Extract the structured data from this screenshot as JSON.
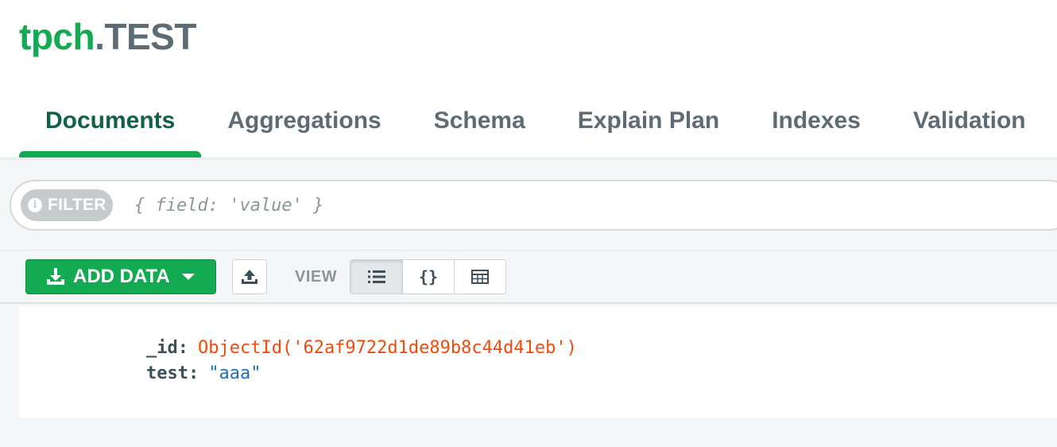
{
  "header": {
    "database": "tpch",
    "collection": ".TEST"
  },
  "tabs": [
    {
      "label": "Documents",
      "active": true
    },
    {
      "label": "Aggregations",
      "active": false
    },
    {
      "label": "Schema",
      "active": false
    },
    {
      "label": "Explain Plan",
      "active": false
    },
    {
      "label": "Indexes",
      "active": false
    },
    {
      "label": "Validation",
      "active": false
    }
  ],
  "filter": {
    "label": "FILTER",
    "icon": "info-icon",
    "placeholder": "{ field: 'value' }",
    "value": ""
  },
  "toolbar": {
    "add_data_label": "ADD DATA",
    "add_data_icon": "download-icon",
    "export_icon": "export-icon",
    "view_label": "VIEW",
    "view_modes": [
      {
        "name": "list-view",
        "icon": "list-icon",
        "active": true
      },
      {
        "name": "json-view",
        "icon": "braces-icon",
        "glyph": "{}",
        "active": false
      },
      {
        "name": "table-view",
        "icon": "table-icon",
        "active": false
      }
    ]
  },
  "documents": [
    {
      "fields": [
        {
          "key": "_id",
          "value": "ObjectId('62af9722d1de89b8c44d41eb')",
          "type": "objectid"
        },
        {
          "key": "test",
          "value": "\"aaa\"",
          "type": "string"
        }
      ]
    }
  ],
  "colors": {
    "brand_green": "#13aa52",
    "active_tab_text": "#116149",
    "objectid_value": "#ef4c0c",
    "string_value": "#1a6ec0"
  }
}
